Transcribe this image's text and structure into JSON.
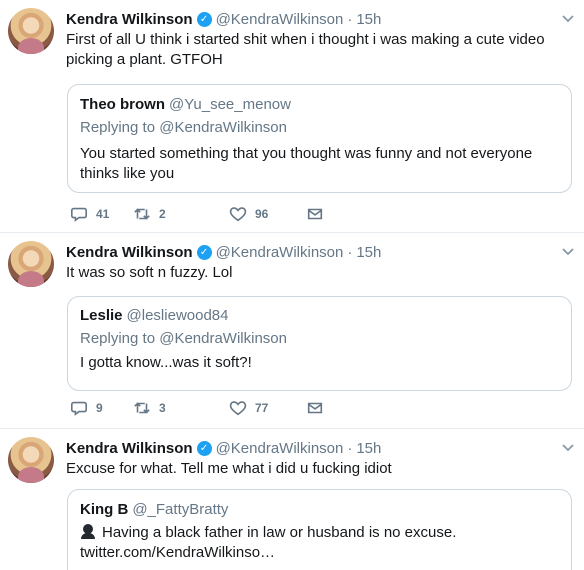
{
  "tweets": [
    {
      "name": "Kendra Wilkinson",
      "handle": "@KendraWilkinson",
      "dot": "·",
      "time": "15h",
      "text": "First of all U think i started shit when i thought i was making a cute video picking a plant. GTFOH",
      "quote": {
        "name": "Theo brown",
        "handle": "@Yu_see_menow",
        "replying": "Replying to @KendraWilkinson",
        "text": "You started something that you thought was funny and not everyone thinks like you"
      },
      "replies": "41",
      "retweets": "2",
      "likes": "96"
    },
    {
      "name": "Kendra Wilkinson",
      "handle": "@KendraWilkinson",
      "dot": "·",
      "time": "15h",
      "text": "It was so soft n fuzzy. Lol",
      "quote": {
        "name": "Leslie",
        "handle": "@lesliewood84",
        "replying": "Replying to @KendraWilkinson",
        "text": "I gotta know...was it soft?!"
      },
      "replies": "9",
      "retweets": "3",
      "likes": "77"
    },
    {
      "name": "Kendra Wilkinson",
      "handle": "@KendraWilkinson",
      "dot": "·",
      "time": "15h",
      "text": "Excuse for what. Tell me what i did u fucking idiot",
      "quote": {
        "name": "King B",
        "handle": "@_FattyBratty",
        "text": "Having a black father in law or husband is no excuse.",
        "link": "twitter.com/KendraWilkinso…"
      }
    }
  ],
  "icons": {
    "verified": "verified-badge-icon",
    "caret": "chevron-down-icon",
    "reply": "reply-icon",
    "retweet": "retweet-icon",
    "like": "heart-icon",
    "dm": "envelope-icon"
  },
  "colors": {
    "verified": "#1da1f2",
    "secondary_text": "#657786",
    "border": "#e6ecf0"
  }
}
